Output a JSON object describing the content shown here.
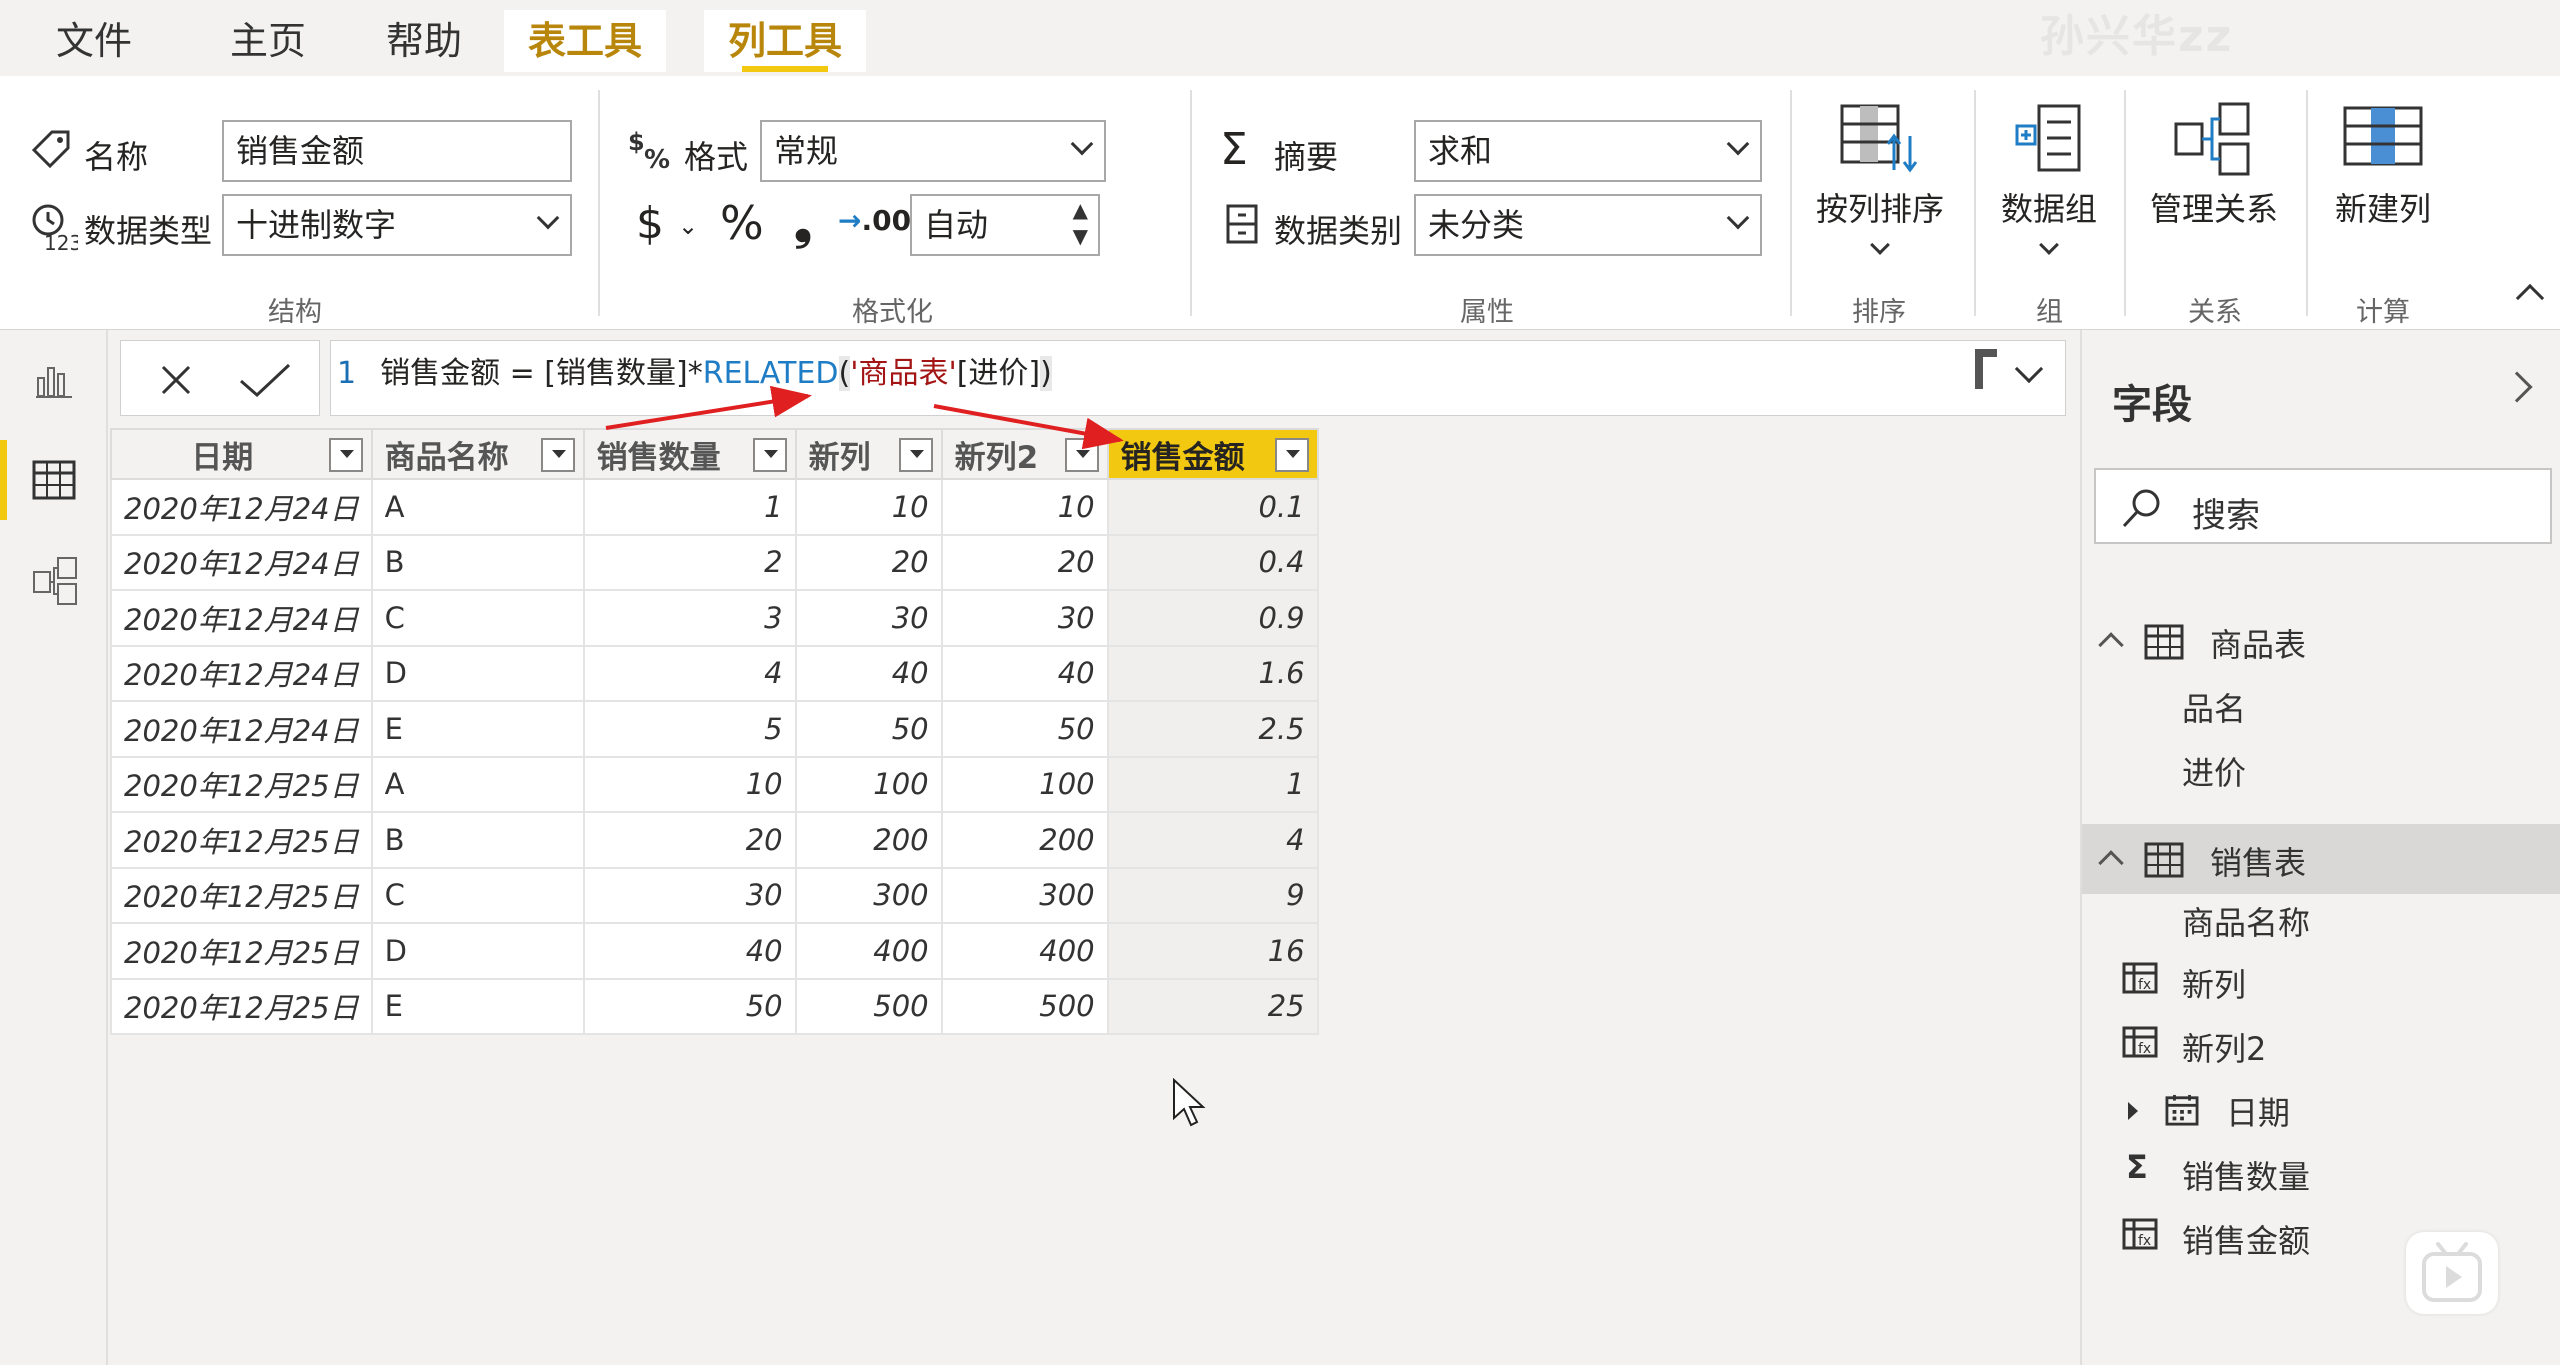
{
  "menu": {
    "file": "文件",
    "home": "主页",
    "help": "帮助",
    "table_tools": "表工具",
    "column_tools": "列工具"
  },
  "watermark": "孙兴华zz",
  "ribbon": {
    "name_label": "名称",
    "name_value": "销售金额",
    "datatype_label": "数据类型",
    "datatype_value": "十进制数字",
    "structure_title": "结构",
    "format_label": "格式",
    "format_value": "常规",
    "currency_symbol": "$",
    "percent_symbol": "%",
    "comma_symbol": "❟",
    "decimal_symbol": ".00",
    "decimal_value": "自动",
    "formatting_title": "格式化",
    "summarize_label": "摘要",
    "summarize_value": "求和",
    "datacategory_label": "数据类别",
    "datacategory_value": "未分类",
    "properties_title": "属性",
    "sort_by_column": "按列排序",
    "sort_title": "排序",
    "data_groups": "数据组",
    "groups_title": "组",
    "manage_relationships": "管理关系",
    "relationships_title": "关系",
    "new_column": "新建列",
    "calculations_title": "计算"
  },
  "formula": {
    "line_number": "1",
    "prefix": "销售金额 = [销售数量]*",
    "keyword": "RELATED",
    "open_paren": "(",
    "table_ref": "'商品表'",
    "column_ref": "[进价]",
    "close_paren": ")"
  },
  "table": {
    "headers": [
      "日期",
      "商品名称",
      "销售数量",
      "新列",
      "新列2",
      "销售金额"
    ],
    "rows": [
      [
        "2020年12月24日",
        "A",
        "1",
        "10",
        "10",
        "0.1"
      ],
      [
        "2020年12月24日",
        "B",
        "2",
        "20",
        "20",
        "0.4"
      ],
      [
        "2020年12月24日",
        "C",
        "3",
        "30",
        "30",
        "0.9"
      ],
      [
        "2020年12月24日",
        "D",
        "4",
        "40",
        "40",
        "1.6"
      ],
      [
        "2020年12月24日",
        "E",
        "5",
        "50",
        "50",
        "2.5"
      ],
      [
        "2020年12月25日",
        "A",
        "10",
        "100",
        "100",
        "1"
      ],
      [
        "2020年12月25日",
        "B",
        "20",
        "200",
        "200",
        "4"
      ],
      [
        "2020年12月25日",
        "C",
        "30",
        "300",
        "300",
        "9"
      ],
      [
        "2020年12月25日",
        "D",
        "40",
        "400",
        "400",
        "16"
      ],
      [
        "2020年12月25日",
        "E",
        "50",
        "500",
        "500",
        "25"
      ]
    ]
  },
  "fields_pane": {
    "title": "字段",
    "search_placeholder": "搜索",
    "tables": [
      {
        "name": "商品表",
        "fields": [
          "品名",
          "进价"
        ]
      },
      {
        "name": "销售表",
        "fields": [
          "商品名称",
          "新列",
          "新列2",
          "日期",
          "销售数量",
          "销售金额"
        ]
      }
    ]
  },
  "colors": {
    "accent": "#f2c811",
    "tool_tab_text": "#b8860b",
    "dax_keyword": "#1f7dc6",
    "dax_string": "#a31515",
    "annotation_arrow": "#e02020"
  }
}
